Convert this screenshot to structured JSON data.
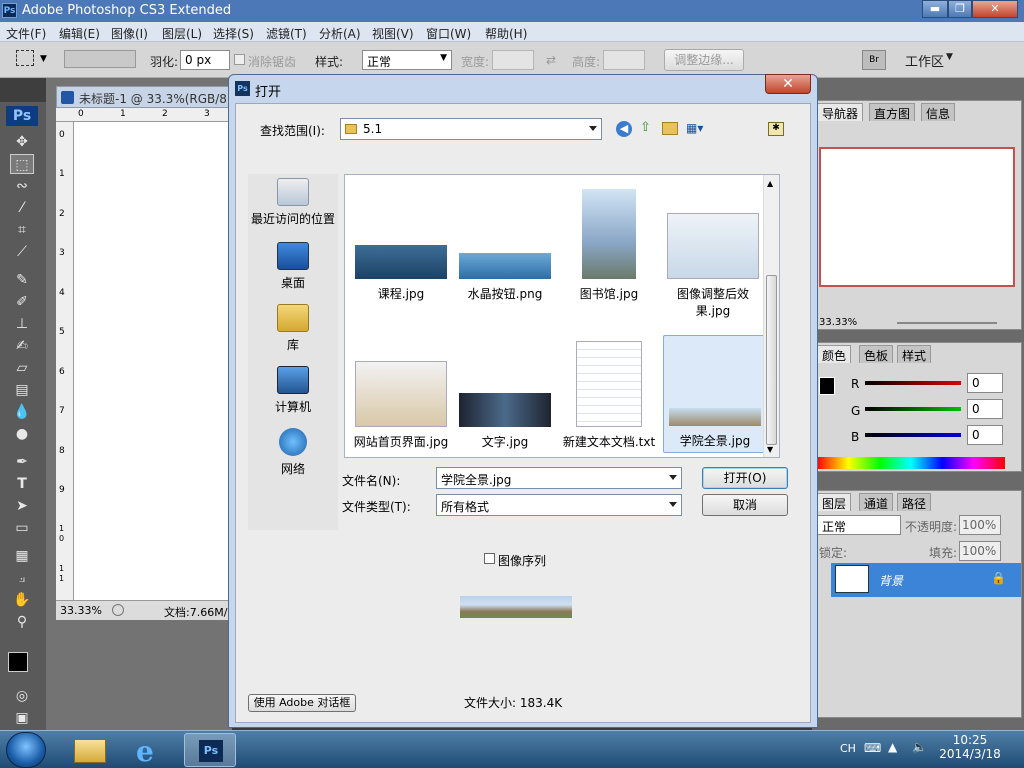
{
  "app": {
    "title": "Adobe Photoshop CS3 Extended",
    "logo": "Ps"
  },
  "window_controls": {
    "minimize": "▬",
    "restore": "❐",
    "close": "✕"
  },
  "menubar": [
    "文件(F)",
    "编辑(E)",
    "图像(I)",
    "图层(L)",
    "选择(S)",
    "滤镜(T)",
    "分析(A)",
    "视图(V)",
    "窗口(W)",
    "帮助(H)"
  ],
  "options": {
    "feather_label": "羽化:",
    "feather_value": "0 px",
    "antialias_label": "消除锯齿",
    "style_label": "样式:",
    "style_value": "正常",
    "width_label": "宽度:",
    "height_label": "高度:",
    "refine_edge": "调整边缘...",
    "workspace": "工作区"
  },
  "document": {
    "tab_title": "未标题-1 @ 33.3%(RGB/8",
    "zoom": "33.33%",
    "doc_size": "文档:7.66M/",
    "ruler_top": [
      "0",
      "1",
      "2",
      "3"
    ],
    "ruler_left": [
      "0",
      "1",
      "2",
      "3",
      "4",
      "5",
      "6",
      "7",
      "8",
      "9",
      "1 0",
      "1 1"
    ]
  },
  "panels": {
    "navigator_tabs": [
      "导航器",
      "直方图",
      "信息"
    ],
    "navigator_zoom": "33.33%",
    "color_tabs": [
      "颜色",
      "色板",
      "样式"
    ],
    "color_channels": [
      {
        "name": "R",
        "value": "0"
      },
      {
        "name": "G",
        "value": "0"
      },
      {
        "name": "B",
        "value": "0"
      }
    ],
    "layer_tabs": [
      "图层",
      "通道",
      "路径"
    ],
    "blend_mode": "正常",
    "opacity_label": "不透明度:",
    "opacity_value": "100%",
    "lock_label": "锁定:",
    "fill_label": "填充:",
    "fill_value": "100%",
    "layer_name": "背景"
  },
  "dialog": {
    "title": "打开",
    "close": "✕",
    "look_in_label": "查找范围(I):",
    "look_in_value": "5.1",
    "places": [
      "最近访问的位置",
      "桌面",
      "库",
      "计算机",
      "网络"
    ],
    "files": [
      {
        "name": "课程.jpg"
      },
      {
        "name": "水晶按钮.png"
      },
      {
        "name": "图书馆.jpg"
      },
      {
        "name": "图像调整后效果.jpg"
      },
      {
        "name": "网站首页界面.jpg"
      },
      {
        "name": "文字.jpg"
      },
      {
        "name": "新建文本文档.txt"
      },
      {
        "name": "学院全景.jpg",
        "selected": true
      }
    ],
    "filename_label": "文件名(N):",
    "filename_value": "学院全景.jpg",
    "filetype_label": "文件类型(T):",
    "filetype_value": "所有格式",
    "open_button": "打开(O)",
    "cancel_button": "取消",
    "image_sequence": "图像序列",
    "file_size": "文件大小: 183.4K",
    "adobe_dialog_button": "使用 Adobe 对话框"
  },
  "taskbar": {
    "lang": "CH",
    "time": "10:25",
    "date": "2014/3/18"
  }
}
